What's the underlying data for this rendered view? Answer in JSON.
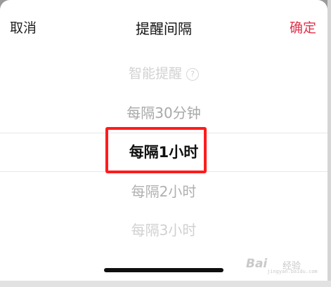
{
  "header": {
    "cancel_label": "取消",
    "title": "提醒间隔",
    "confirm_label": "确定"
  },
  "picker": {
    "items": [
      {
        "label": "智能提醒",
        "state": "disabled",
        "has_help_icon": true
      },
      {
        "label": "每隔30分钟",
        "state": "normal"
      },
      {
        "label": "每隔1小时",
        "state": "selected"
      },
      {
        "label": "每隔2小时",
        "state": "normal"
      },
      {
        "label": "每隔3小时",
        "state": "normal"
      }
    ],
    "help_icon_glyph": "?",
    "selected_value": "每隔1小时"
  },
  "watermark": {
    "brand": "Bai",
    "jingyan": "经验",
    "url": "jingyan.baidu.com"
  },
  "colors": {
    "confirm": "#e0324a",
    "highlight_box": "#ff1c1c",
    "selected_text": "#111111"
  }
}
